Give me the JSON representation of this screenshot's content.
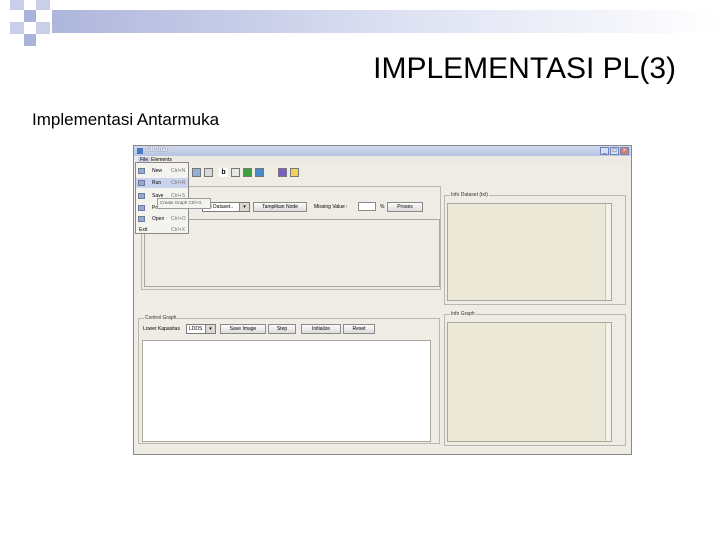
{
  "slide": {
    "title": "IMPLEMENTASI PL(3)",
    "subtitle": "Implementasi Antarmuka"
  },
  "window": {
    "title": "CB Star",
    "controls": [
      "_",
      "□",
      "×"
    ]
  },
  "menubar": {
    "items": [
      "File",
      "Elements"
    ]
  },
  "file_menu": {
    "items": [
      {
        "label": "New",
        "shortcut": "Ctrl+N"
      },
      {
        "label": "Run",
        "shortcut": "Ctrl+R"
      },
      {
        "label": "Save",
        "shortcut": "Ctrl+S"
      },
      {
        "label": "Print",
        "shortcut": "Ctrl+P"
      },
      {
        "label": "Open",
        "shortcut": "Ctrl+O"
      },
      {
        "label": "Exit",
        "shortcut": "Ctrl+X"
      }
    ],
    "submenu_label": "Create Graph  Ctrl+G"
  },
  "toolbar_row": {
    "combo_value": "..di Dataset..",
    "show_node_button": "Tampilkan Node",
    "missing_value_label": "Missing Value :",
    "percent_symbol": "%",
    "process_button": "Proses"
  },
  "info_dataset": {
    "title": "Info Dataset (txt)"
  },
  "control_graph": {
    "title": "Control Graph",
    "layout_label": "Lower Kapasitas",
    "layout_value": "LDDS",
    "save_image_button": "Save Image",
    "step_button": "Step",
    "initialize_button": "Initialize",
    "reset_button": "Reset"
  },
  "info_graph": {
    "title": "Info Graph"
  },
  "colors": {
    "accent_bar": "#aeb6dc",
    "window_bg": "#eeece4",
    "textarea_beige": "#ece9d8",
    "menu_highlight": "#c9d3ec"
  }
}
